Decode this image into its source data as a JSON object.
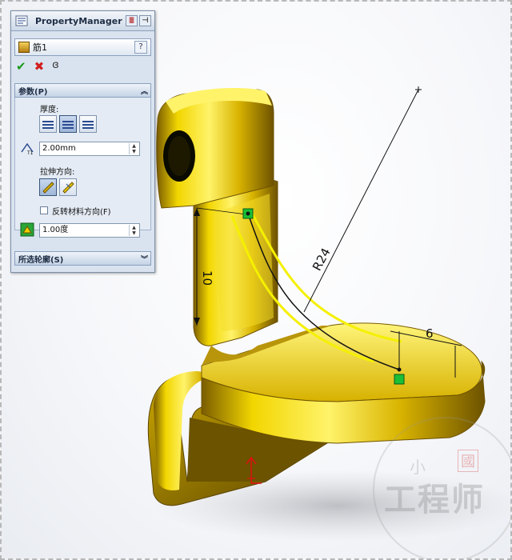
{
  "colors": {
    "part_gold": "#e6c400",
    "part_shadow": "#8a6f00",
    "sketch_line": "#111111",
    "rib_preview": "#f5f000",
    "point_green": "#1bbf35",
    "annotation_red": "#e01010",
    "panel_bg": "#d9e3f0"
  },
  "property_manager": {
    "title": "PropertyManager",
    "feature_name": "筋1",
    "help_label": "?",
    "icons": [
      "property-manager-icon",
      "pin-icon",
      "rib-feature-icon",
      "ok-checkmark-icon",
      "cancel-x-icon",
      "detailed-preview-icon"
    ],
    "parameters_section": {
      "header": "参数(P)",
      "thickness_label": "厚度:",
      "thickness_options": [
        "first-side",
        "both-sides",
        "second-side"
      ],
      "thickness_selected": "both-sides",
      "thickness_value": "2.00mm",
      "extrusion_direction_label": "拉伸方向:",
      "extrusion_options": [
        "parallel-to-sketch",
        "normal-to-sketch"
      ],
      "extrusion_selected": "parallel-to-sketch",
      "flip_material_label": "反转材料方向(F)",
      "flip_material_checked": false,
      "draft_value": "1.00度"
    },
    "selected_contours_section": {
      "header": "所选轮廓(S)"
    }
  },
  "graphics": {
    "dimension_radius": "R24",
    "dimension_height": "10",
    "dimension_offset": "6"
  },
  "watermark": {
    "text": "工程师",
    "stamp": "國",
    "top_text": "小"
  }
}
